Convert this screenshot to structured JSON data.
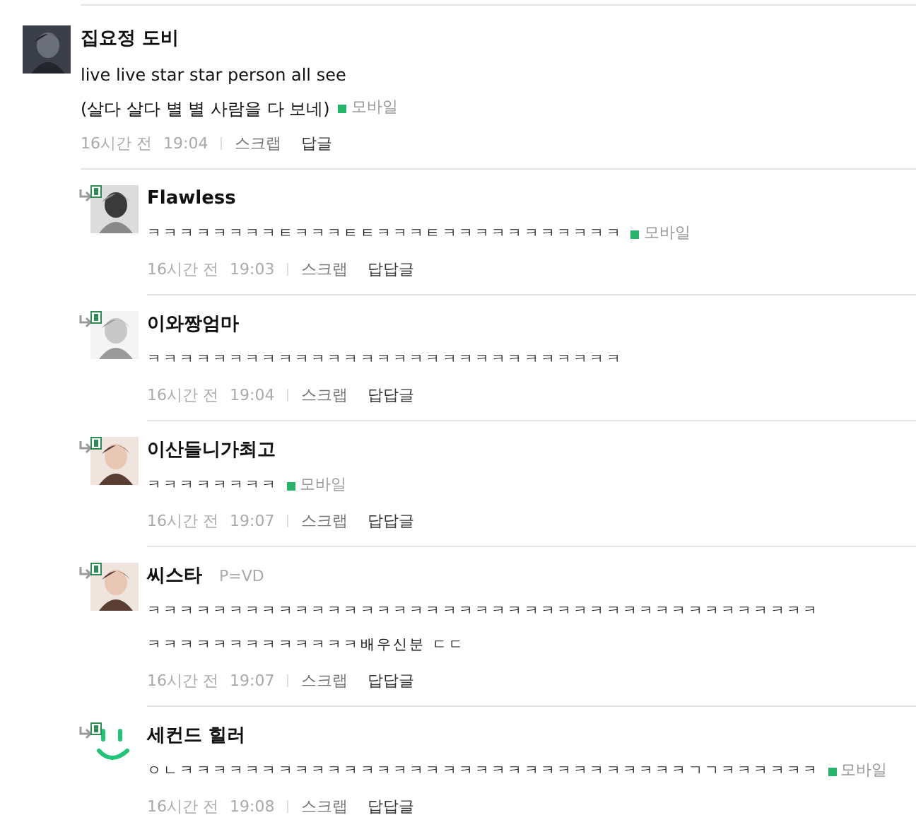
{
  "comments": [
    {
      "kind": "comment",
      "author": "집요정 도비",
      "lines": [
        "live live star star person all see",
        "(살다 살다 별 별 사람을 다 보네)"
      ],
      "mobile": "모바일",
      "time_ago": "16시간 전",
      "time": "19:04",
      "scrap": "스크랩",
      "reply": "답글",
      "avatar": {
        "kind": "picture"
      }
    },
    {
      "kind": "reply",
      "author": "Flawless",
      "lines": [
        "ㅋㅋㅋㅋㅋㅋㅋㅋㅌㅋㅋㅋㅌㅌㅋㅋㅋㅌㅋㅋㅋㅋㅋㅋㅋㅋㅋㅋㅋ"
      ],
      "mobile": "모바일",
      "time_ago": "16시간 전",
      "time": "19:03",
      "scrap": "스크랩",
      "reply": "답답글",
      "avatar": {
        "kind": "picture"
      }
    },
    {
      "kind": "reply",
      "author": "이와짱엄마",
      "lines": [
        "ㅋㅋㅋㅋㅋㅋㅋㅋㅋㅋㅋㅋㅋㅋㅋㅋㅋㅋㅋㅋㅋㅋㅋㅋㅋㅋㅋㅋㅋ"
      ],
      "time_ago": "16시간 전",
      "time": "19:04",
      "scrap": "스크랩",
      "reply": "답답글",
      "avatar": {
        "kind": "picture"
      }
    },
    {
      "kind": "reply",
      "author": "이산들니가최고",
      "lines": [
        "ㅋㅋㅋㅋㅋㅋㅋㅋ"
      ],
      "mobile": "모바일",
      "time_ago": "16시간 전",
      "time": "19:07",
      "scrap": "스크랩",
      "reply": "답답글",
      "avatar": {
        "kind": "picture"
      }
    },
    {
      "kind": "reply",
      "author": "씨스타",
      "tag": "P=VD",
      "lines": [
        "ㅋㅋㅋㅋㅋㅋㅋㅋㅋㅋㅋㅋㅋㅋㅋㅋㅋㅋㅋㅋㅋㅋㅋㅋㅋㅋㅋㅋㅋㅋㅋㅋㅋㅋㅋㅋㅋㅋㅋㅋㅋ",
        "ㅋㅋㅋㅋㅋㅋㅋㅋㅋㅋㅋㅋㅋ배우신분 ㄷㄷ"
      ],
      "time_ago": "16시간 전",
      "time": "19:07",
      "scrap": "스크랩",
      "reply": "답답글",
      "avatar": {
        "kind": "picture"
      }
    },
    {
      "kind": "reply",
      "author": "세컨드 힐러",
      "lines": [
        "ㅇㄴㅋㅋㅋㅋㅋㅋㅋㅋㅋㅋㅋㅋㅋㅋㅋㅋㅋㅋㅋㅋㅋㅋㅋㅋㅋㅋㅋㅋㅋㅋㅋㄱㄱㅋㅋㅋㅋㅋㅋ"
      ],
      "mobile": "모바일",
      "time_ago": "16시간 전",
      "time": "19:08",
      "scrap": "스크랩",
      "reply": "답답글",
      "avatar": {
        "kind": "smile"
      }
    }
  ]
}
